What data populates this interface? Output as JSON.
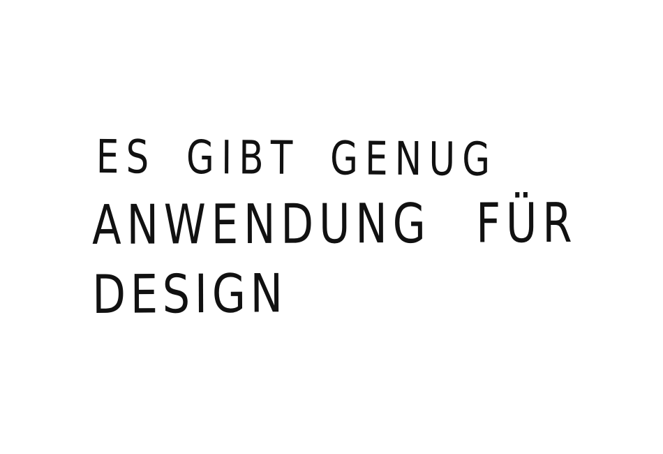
{
  "note": {
    "lines": [
      "ES GIBT GENUG",
      "ANWENDUNG FÜR",
      "DESIGN"
    ]
  },
  "colors": {
    "ink": "#111111",
    "paper": "#ffffff"
  }
}
